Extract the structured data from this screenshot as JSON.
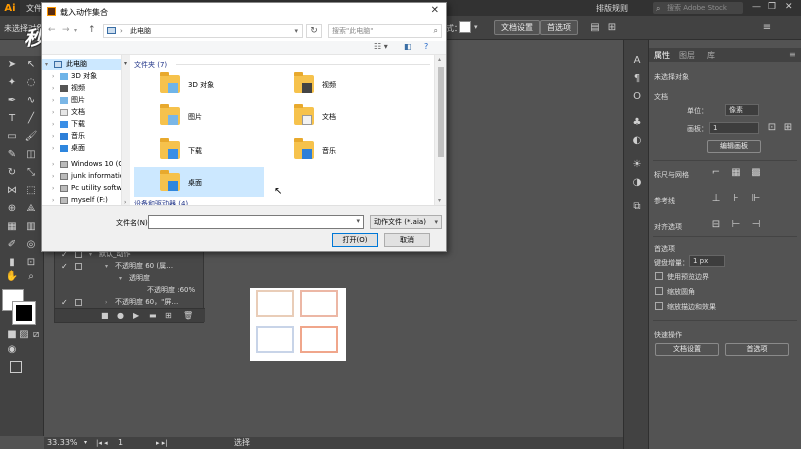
{
  "app": {
    "logo": "Ai",
    "menu_file": "文件",
    "workspace": "排版规则",
    "search_placeholder": "搜索 Adobe Stock",
    "window_controls": [
      "—",
      "❐",
      "✕"
    ]
  },
  "controlbar": {
    "selection_status": "未选择对象",
    "style_label": "式：",
    "doc_setup": "文档设置",
    "preferences": "首选项"
  },
  "watermark": "秒懂视频",
  "dialog": {
    "title": "载入动作集合",
    "close": "✕",
    "address_path": "此电脑",
    "search_placeholder": "搜索\"此电脑\"",
    "nav_items": [
      {
        "label": "此电脑",
        "icon": "pc-icon",
        "selected": true
      },
      {
        "label": "3D 对象",
        "icon": "3d-objects-icon"
      },
      {
        "label": "视频",
        "icon": "videos-icon"
      },
      {
        "label": "图片",
        "icon": "pictures-icon"
      },
      {
        "label": "文档",
        "icon": "documents-icon"
      },
      {
        "label": "下载",
        "icon": "downloads-icon"
      },
      {
        "label": "音乐",
        "icon": "music-icon"
      },
      {
        "label": "桌面",
        "icon": "desktop-icon"
      },
      {
        "label": "Windows 10 (C",
        "icon": "drive-icon"
      },
      {
        "label": "junk informatio",
        "icon": "drive-icon"
      },
      {
        "label": "Pc  utility softw",
        "icon": "drive-icon"
      },
      {
        "label": "myself (F:)",
        "icon": "drive-icon"
      }
    ],
    "folders_group": "文件夹 (7)",
    "devices_group": "设备和驱动器 (4)",
    "folders": [
      {
        "label": "3D 对象",
        "icon": "3d-objects-icon"
      },
      {
        "label": "视频",
        "icon": "videos-icon"
      },
      {
        "label": "图片",
        "icon": "pictures-icon"
      },
      {
        "label": "文档",
        "icon": "documents-icon"
      },
      {
        "label": "下载",
        "icon": "downloads-icon"
      },
      {
        "label": "音乐",
        "icon": "music-icon"
      },
      {
        "label": "桌面",
        "icon": "desktop-icon",
        "selected": true
      }
    ],
    "filename_label": "文件名(N):",
    "filename_value": "",
    "filetype": "动作文件 (*.aia)",
    "open_button": "打开(O)",
    "cancel_button": "取消"
  },
  "actions_panel": {
    "rows": [
      {
        "label": "默认_动作",
        "indent": 1
      },
      {
        "label": "不透明度 60 (属…",
        "indent": 1
      },
      {
        "label": "透明度",
        "indent": 2
      },
      {
        "label": "不透明度 :60%",
        "indent": 3
      },
      {
        "label": "不透明度 60，\"屏…",
        "indent": 1
      }
    ]
  },
  "statusbar": {
    "zoom": "33.33%",
    "artboard_num": "1",
    "tool": "选择"
  },
  "properties": {
    "tabs": [
      "属性",
      "图层",
      "库"
    ],
    "no_selection": "未选择对象",
    "document_section": "文档",
    "units_label": "单位：",
    "units_value": "像素",
    "artboard_label": "画板：",
    "artboard_value": "1",
    "edit_artboards": "编辑画板",
    "rulers_grids": "标尺与网格",
    "guides": "参考线",
    "align_options": "对齐选项",
    "preferences_section": "首选项",
    "keyboard_increment_label": "键盘增量：",
    "keyboard_increment_value": "1 px",
    "use_preview_bounds": "使用预览边界",
    "scale_corners": "缩放圆角",
    "scale_strokes": "缩放描边和效果",
    "quick_actions": "快速操作",
    "doc_setup_btn": "文档设置",
    "prefs_btn": "首选项"
  },
  "colors": {
    "ai_orange": "#ff9a00",
    "selection_blue": "#cce8ff",
    "folder_yellow": "#f6c24c"
  }
}
